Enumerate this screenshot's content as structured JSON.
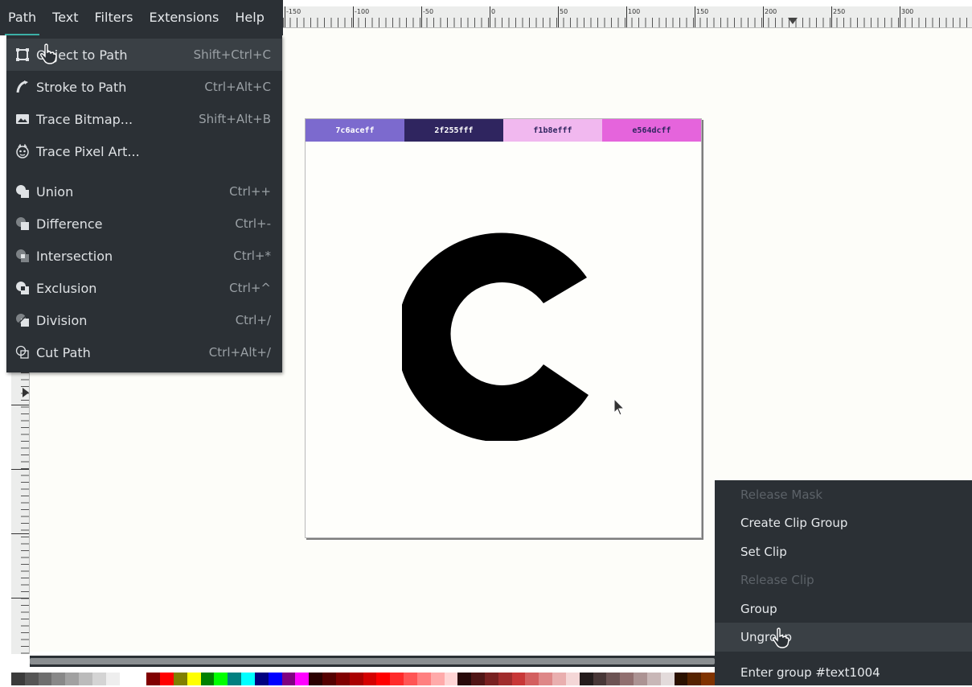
{
  "menubar": {
    "items": [
      {
        "label": "Path",
        "active": true
      },
      {
        "label": "Text"
      },
      {
        "label": "Filters"
      },
      {
        "label": "Extensions"
      },
      {
        "label": "Help"
      }
    ]
  },
  "ruler": {
    "labels": [
      "-150",
      "-100",
      "-50",
      "0",
      "50",
      "100",
      "150",
      "200",
      "250",
      "300"
    ]
  },
  "path_menu": {
    "items": [
      {
        "label": "Object to Path",
        "shortcut": "Shift+Ctrl+C",
        "icon": "object-to-path-icon",
        "hover": true
      },
      {
        "label": "Stroke to Path",
        "shortcut": "Ctrl+Alt+C",
        "icon": "stroke-to-path-icon"
      },
      {
        "label": "Trace Bitmap...",
        "shortcut": "Shift+Alt+B",
        "icon": "trace-bitmap-icon"
      },
      {
        "label": "Trace Pixel Art...",
        "shortcut": "",
        "icon": "trace-pixel-art-icon"
      },
      {
        "label": "Union",
        "shortcut": "Ctrl++",
        "icon": "union-icon"
      },
      {
        "label": "Difference",
        "shortcut": "Ctrl+-",
        "icon": "difference-icon"
      },
      {
        "label": "Intersection",
        "shortcut": "Ctrl+*",
        "icon": "intersection-icon"
      },
      {
        "label": "Exclusion",
        "shortcut": "Ctrl+^",
        "icon": "exclusion-icon"
      },
      {
        "label": "Division",
        "shortcut": "Ctrl+/",
        "icon": "division-icon"
      },
      {
        "label": "Cut Path",
        "shortcut": "Ctrl+Alt+/",
        "icon": "cut-path-icon"
      }
    ]
  },
  "page_swatches": [
    {
      "label": "7c6aceff",
      "color": "#7c6ace",
      "text_color": "#ffffff"
    },
    {
      "label": "2f255fff",
      "color": "#2f255f",
      "text_color": "#ffffff"
    },
    {
      "label": "f1b8efff",
      "color": "#f1b8ef",
      "text_color": "#2f255f"
    },
    {
      "label": "e564dcff",
      "color": "#e564dc",
      "text_color": "#2f255f"
    }
  ],
  "context_menu": {
    "items": [
      {
        "label": "Release Mask",
        "disabled": true
      },
      {
        "label": "Create Clip Group"
      },
      {
        "label": "Set Clip"
      },
      {
        "label": "Release Clip",
        "disabled": true
      },
      {
        "label": "Group"
      },
      {
        "label": "Ungroup",
        "hover": true
      },
      {
        "label": "Enter group #text1004"
      }
    ]
  },
  "palette_colors": [
    "#3b3b3b",
    "#555555",
    "#6e6e6e",
    "#888888",
    "#a1a1a1",
    "#bbbbbb",
    "#d4d4d4",
    "#eeeeee",
    "#ffffff",
    "#ffffff",
    "#800000",
    "#ff0000",
    "#808000",
    "#ffff00",
    "#008000",
    "#00ff00",
    "#008080",
    "#00ffff",
    "#000080",
    "#0000ff",
    "#800080",
    "#ff00ff",
    "#2b0000",
    "#550000",
    "#800000",
    "#aa0000",
    "#d40000",
    "#ff0000",
    "#ff2a2a",
    "#ff5555",
    "#ff8080",
    "#ffaaaa",
    "#ffd5d5",
    "#280b0b",
    "#501616",
    "#782121",
    "#a02c2c",
    "#c83737",
    "#d35f5f",
    "#de8787",
    "#e9afaf",
    "#f4d7d7",
    "#241c1c",
    "#483737",
    "#6c5353",
    "#916f6f",
    "#ac9393",
    "#c8b7b7",
    "#e3dbdb",
    "#2b1100",
    "#552200",
    "#803300"
  ],
  "colors": {
    "menu_bg": "#2b3035",
    "accent": "#3bb0a6"
  }
}
